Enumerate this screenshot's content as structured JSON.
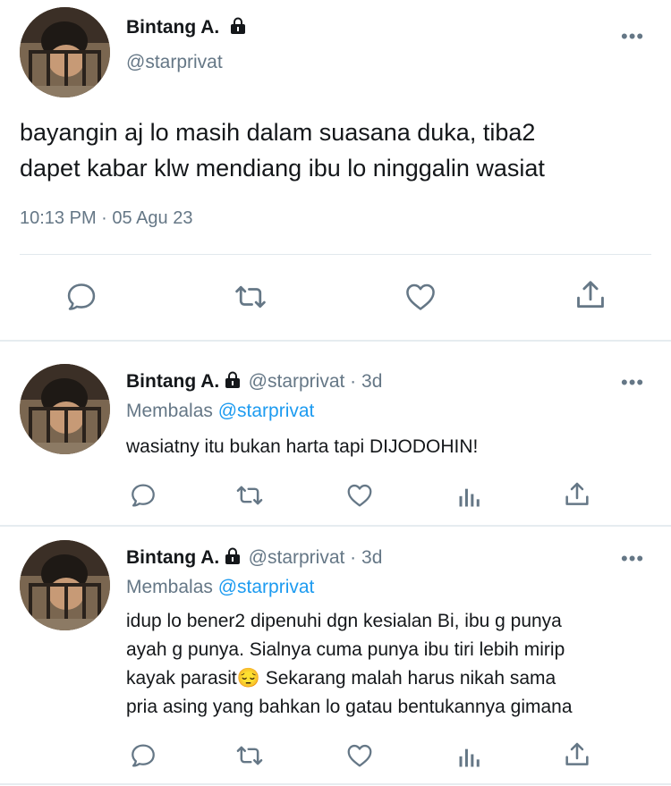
{
  "main_tweet": {
    "author_name": "Bintang A.",
    "author_handle": "@starprivat",
    "text_line1": "bayangin aj lo masih dalam suasana duka, tiba2",
    "text_line2": "dapet kabar klw mendiang ibu lo ninggalin wasiat",
    "timestamp": "10:13 PM · 05 Agu 23",
    "actions": [
      "reply-icon",
      "retweet-icon",
      "like-icon",
      "share-icon"
    ]
  },
  "replies": [
    {
      "author_name": "Bintang A.",
      "author_handle": "@starprivat · 3d",
      "reply_prefix": "Membalas ",
      "reply_mention": "@starprivat",
      "lines": [
        "wasiatny itu bukan harta tapi DIJODOHIN!"
      ],
      "actions": [
        "reply-icon",
        "retweet-icon",
        "like-icon",
        "analytics-icon",
        "share-icon"
      ]
    },
    {
      "author_name": "Bintang A.",
      "author_handle": "@starprivat · 3d",
      "reply_prefix": "Membalas ",
      "reply_mention": "@starprivat",
      "lines": [
        "idup lo bener2 dipenuhi dgn kesialan Bi, ibu g punya",
        "ayah g punya. Sialnya cuma punya ibu tiri lebih mirip",
        "kayak parasit😔 Sekarang malah harus nikah sama",
        "pria asing yang bahkan lo gatau bentukannya gimana"
      ],
      "actions": [
        "reply-icon",
        "retweet-icon",
        "like-icon",
        "analytics-icon",
        "share-icon"
      ]
    }
  ],
  "more_label": "•••",
  "colors": {
    "text": "#14171a",
    "secondary": "#657786",
    "link": "#1d9bf0",
    "divider": "#e1e8ed"
  }
}
